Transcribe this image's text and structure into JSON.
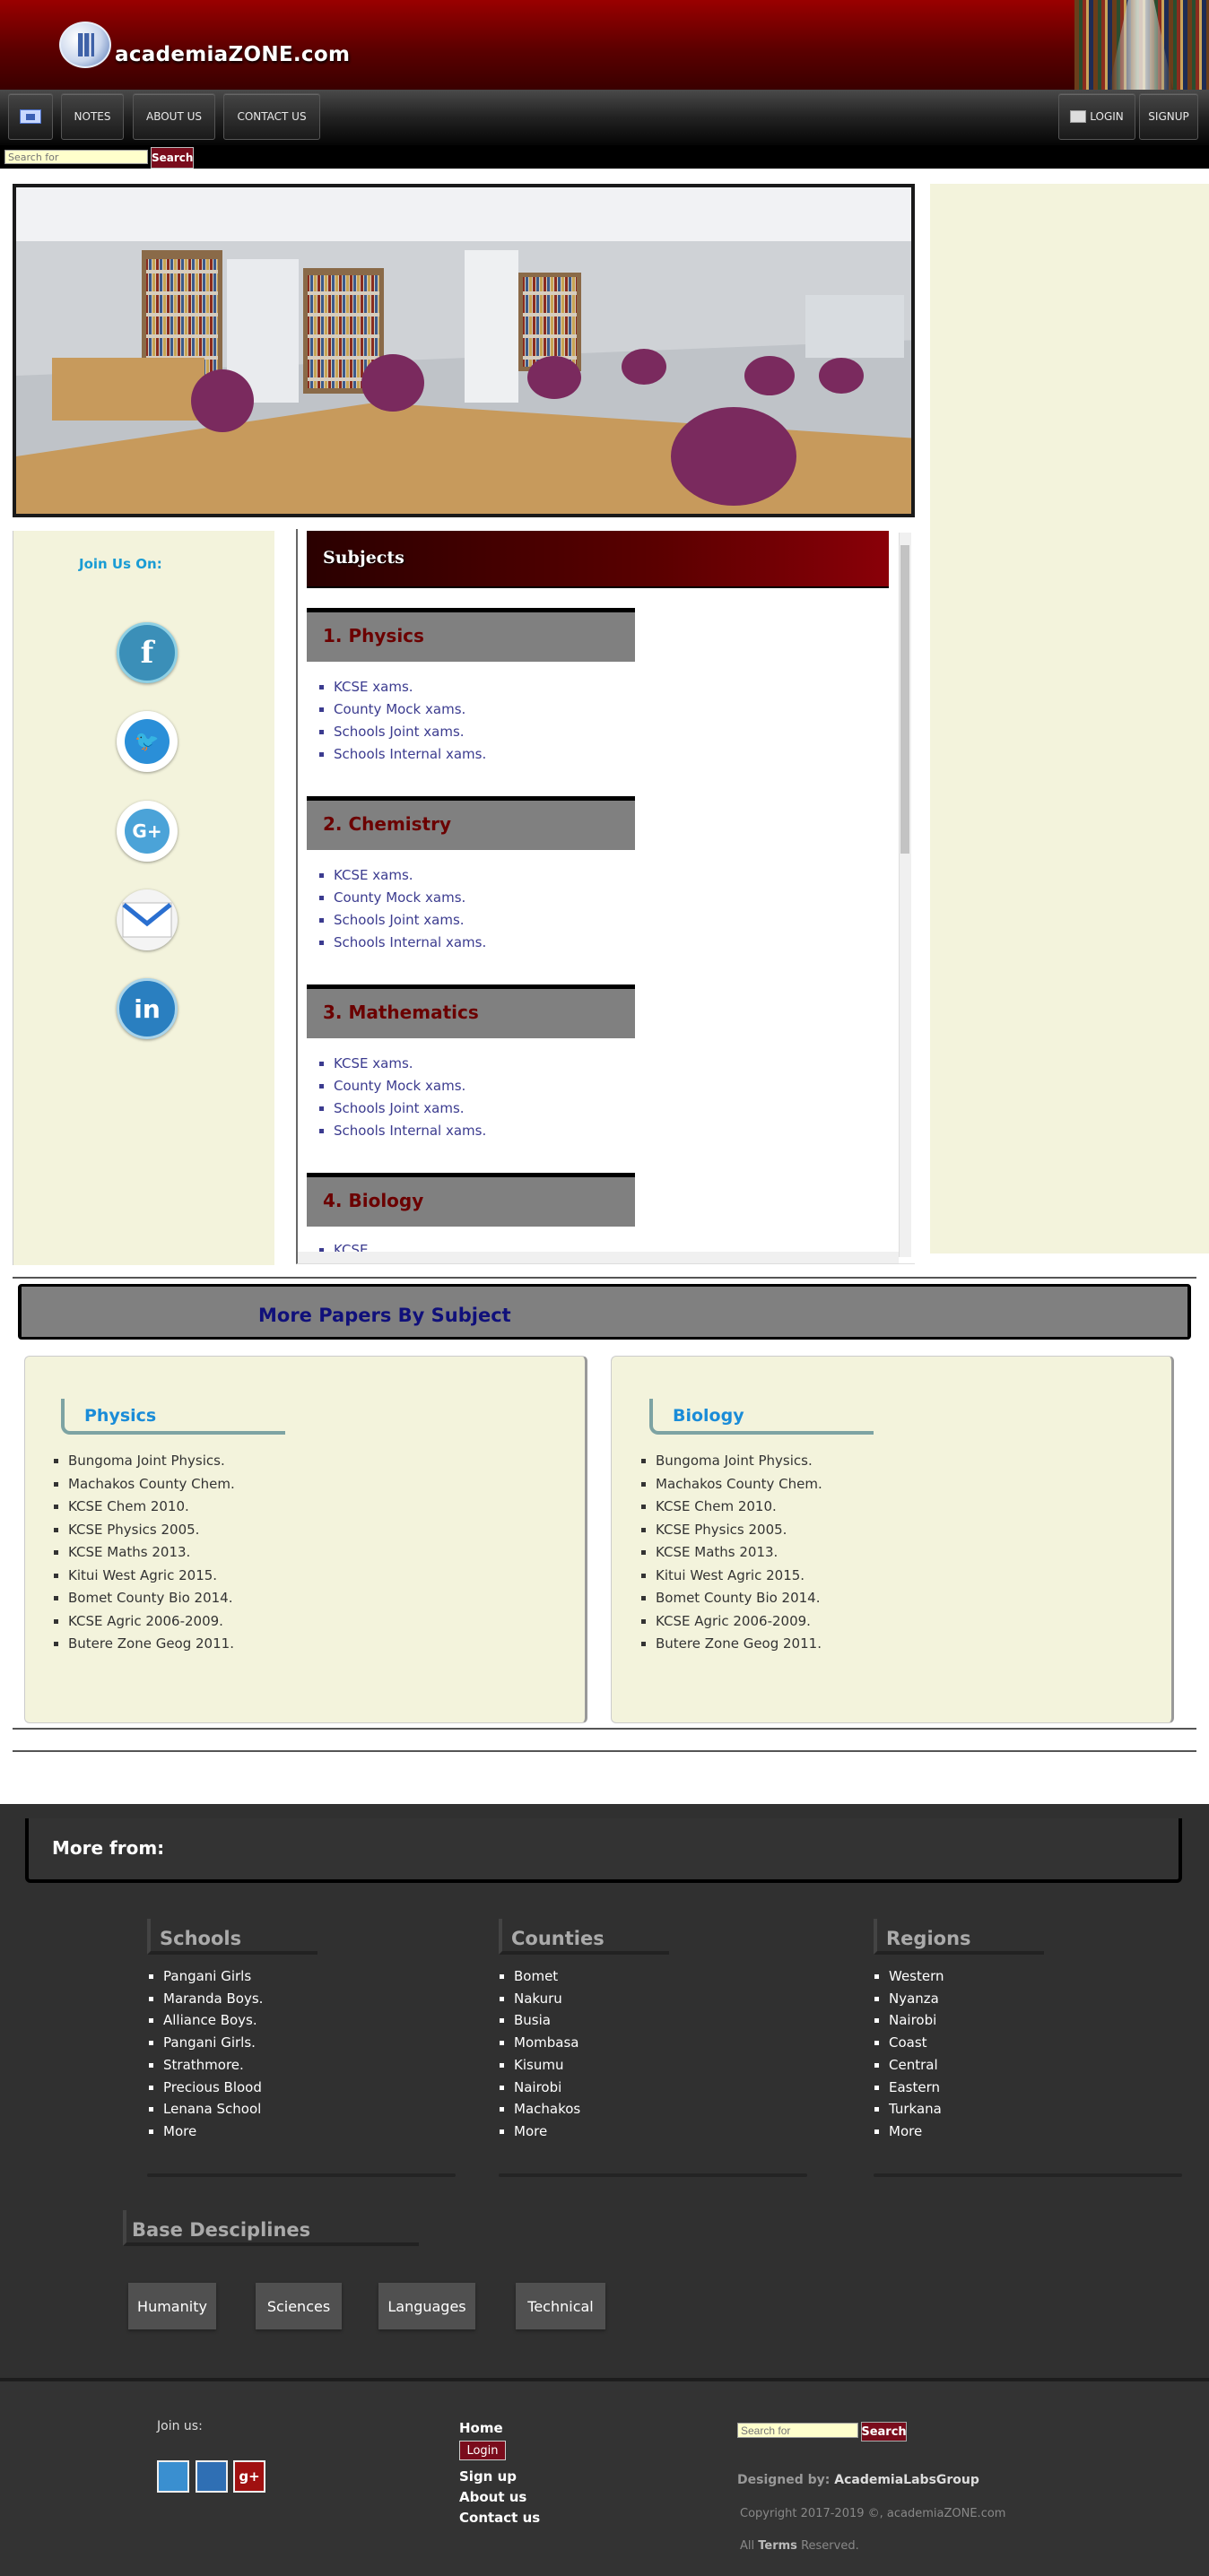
{
  "header": {
    "logo_text": "academiaZONE.com"
  },
  "nav": {
    "notes": "NOTES",
    "about": "ABOUT US",
    "contact": "CONTACT US",
    "login": "LOGIN",
    "signup": "SIGNUP"
  },
  "search": {
    "placeholder": "Search for",
    "button": "Search"
  },
  "social": {
    "label": "Join Us On:",
    "icons": [
      "facebook-icon",
      "twitter-icon",
      "google-plus-icon",
      "mail-icon",
      "linkedin-icon"
    ]
  },
  "subjects": {
    "title": "Subjects",
    "items": [
      {
        "title": "1. Physics",
        "links": [
          "KCSE xams.",
          "County Mock xams.",
          "Schools Joint xams.",
          "Schools Internal xams."
        ]
      },
      {
        "title": "2. Chemistry",
        "links": [
          "KCSE xams.",
          "County Mock xams.",
          "Schools Joint xams.",
          "Schools Internal xams."
        ]
      },
      {
        "title": "3. Mathematics",
        "links": [
          "KCSE xams.",
          "County Mock xams.",
          "Schools Joint xams.",
          "Schools Internal xams."
        ]
      },
      {
        "title": "4. Biology",
        "links": [
          "KCSE"
        ]
      }
    ]
  },
  "more_papers": {
    "title": "More Papers By Subject",
    "cards": [
      {
        "title": "Physics",
        "links": [
          "Bungoma Joint Physics.",
          "Machakos County Chem.",
          "KCSE Chem 2010.",
          "KCSE Physics 2005.",
          "KCSE Maths 2013.",
          "Kitui West Agric 2015.",
          "Bomet County Bio 2014.",
          "KCSE Agric 2006-2009.",
          "Butere Zone Geog 2011."
        ]
      },
      {
        "title": "Biology",
        "links": [
          "Bungoma Joint Physics.",
          "Machakos County Chem.",
          "KCSE Chem 2010.",
          "KCSE Physics 2005.",
          "KCSE Maths 2013.",
          "Kitui West Agric 2015.",
          "Bomet County Bio 2014.",
          "KCSE Agric 2006-2009.",
          "Butere Zone Geog 2011."
        ]
      }
    ]
  },
  "footer": {
    "more_from": "More from:",
    "columns": [
      {
        "title": "Schools",
        "items": [
          "Pangani Girls",
          "Maranda Boys.",
          "Alliance Boys.",
          "Pangani Girls.",
          "Strathmore.",
          "Precious Blood",
          "Lenana School",
          "More"
        ]
      },
      {
        "title": "Counties",
        "items": [
          "Bomet",
          "Nakuru",
          "Busia",
          "Mombasa",
          "Kisumu",
          "Nairobi",
          "Machakos",
          "More"
        ]
      },
      {
        "title": "Regions",
        "items": [
          "Western",
          "Nyanza",
          "Nairobi",
          "Coast",
          "Central",
          "Eastern",
          "Turkana",
          "More"
        ]
      }
    ],
    "base_title": "Base Desciplines",
    "base_buttons": [
      "Humanity",
      "Sciences",
      "Languages",
      "Technical"
    ],
    "join_us": "Join us:",
    "links": {
      "home": "Home",
      "login": "Login",
      "signup": "Sign up",
      "about": "About us",
      "contact": "Contact us"
    },
    "designed_label": "Designed by:",
    "designed_by": "AcademiaLabsGroup",
    "copyright": "Copyright 2017-2019 ©, academiaZONE.com",
    "terms_pre": "All",
    "terms": "Terms",
    "terms_post": "Reserved."
  },
  "colors": {
    "brand": "#8b0000",
    "panel": "#f3f3dc",
    "footer": "#303030",
    "link": "#3b3b8f"
  }
}
